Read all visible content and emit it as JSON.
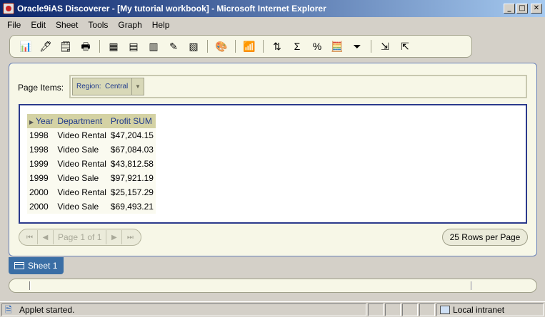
{
  "window": {
    "title": "Oracle9iAS Discoverer - [My tutorial workbook] - Microsoft Internet Explorer",
    "minimize": "_",
    "maximize": "□",
    "close": "✕"
  },
  "menu": [
    "File",
    "Edit",
    "Sheet",
    "Tools",
    "Graph",
    "Help"
  ],
  "toolbar": {
    "icons": [
      "new-workbook-icon",
      "open-workbook-icon",
      "save-icon",
      "print-icon",
      "edit-sheet-icon",
      "table-layout-icon",
      "crosstab-layout-icon",
      "edit-item-icon",
      "pivot-icon",
      "format-icon",
      "graph-icon",
      "sort-icon",
      "sum-icon",
      "percent-icon",
      "calculation-icon",
      "filter-icon",
      "export-icon",
      "drill-icon"
    ]
  },
  "page_items": {
    "label": "Page Items:",
    "region_label": "Region:",
    "region_value": "Central"
  },
  "table": {
    "headers": [
      "Year",
      "Department",
      "Profit SUM"
    ],
    "rows": [
      [
        "1998",
        "Video Rental",
        "$47,204.15"
      ],
      [
        "1998",
        "Video Sale",
        "$67,084.03"
      ],
      [
        "1999",
        "Video Rental",
        "$43,812.58"
      ],
      [
        "1999",
        "Video Sale",
        "$97,921.19"
      ],
      [
        "2000",
        "Video Rental",
        "$25,157.29"
      ],
      [
        "2000",
        "Video Sale",
        "$69,493.21"
      ]
    ]
  },
  "pager": {
    "first": "⏮",
    "prev": "◀",
    "page_label": "Page 1 of 1",
    "next": "▶",
    "last": "⏭",
    "rows_per_page": "25 Rows per Page"
  },
  "sheet_tab": {
    "label": "Sheet 1"
  },
  "status": {
    "text": "Applet started.",
    "zone": "Local intranet"
  }
}
